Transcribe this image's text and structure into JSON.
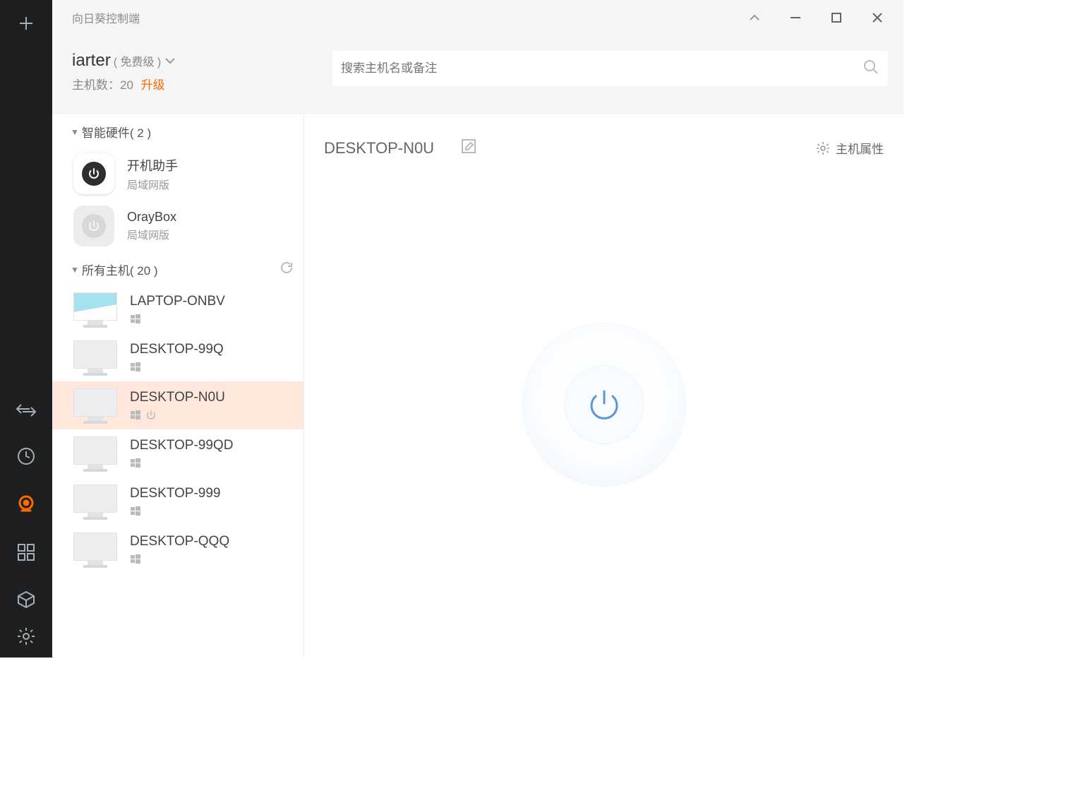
{
  "titlebar": {
    "title": "向日葵控制端"
  },
  "user": {
    "name": "iarter",
    "level": "( 免费级 )",
    "host_count_label": "主机数：",
    "host_count": "20",
    "upgrade_label": "升级"
  },
  "search": {
    "placeholder": "搜索主机名或备注"
  },
  "sections": {
    "smart_hardware": {
      "label": "智能硬件( 2 )"
    },
    "all_hosts": {
      "label": "所有主机( 20 )"
    }
  },
  "hardware": [
    {
      "title": "开机助手",
      "subtitle": "局域网版",
      "iconStyle": "dark"
    },
    {
      "title": "OrayBox",
      "subtitle": "局域网版",
      "iconStyle": "light"
    }
  ],
  "hosts": [
    {
      "name": "LAPTOP-ONBV",
      "online": true,
      "hasPower": false,
      "selected": false
    },
    {
      "name": "DESKTOP-99Q",
      "online": false,
      "hasPower": false,
      "selected": false
    },
    {
      "name": "DESKTOP-N0U",
      "online": false,
      "hasPower": true,
      "selected": true
    },
    {
      "name": "DESKTOP-99QD",
      "online": false,
      "hasPower": false,
      "selected": false
    },
    {
      "name": "DESKTOP-999",
      "online": false,
      "hasPower": false,
      "selected": false
    },
    {
      "name": "DESKTOP-QQQ",
      "online": false,
      "hasPower": false,
      "selected": false
    }
  ],
  "details": {
    "host_name": "DESKTOP-N0U",
    "properties_label": "主机属性"
  },
  "colors": {
    "accent": "#ff6a00"
  }
}
